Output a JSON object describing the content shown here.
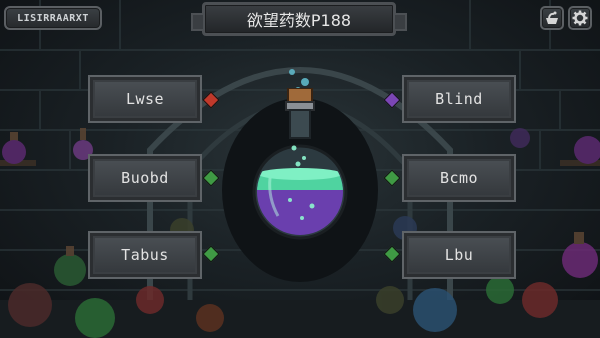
{
  "header": {
    "player_label": "LISIRRAARXT",
    "title": "欲望药数P188"
  },
  "icons": {
    "shop": "potion-shop-icon",
    "settings": "gear-icon"
  },
  "options": {
    "left_top": "Lwse",
    "left_mid": "Buobd",
    "left_bot": "Tabus",
    "right_top": "Blind",
    "right_mid": "Bcmo",
    "right_bot": "Lbu"
  },
  "colors": {
    "gem_red": "#c0392b",
    "gem_green": "#3f9a44",
    "gem_purple": "#7b46b5",
    "potion_liquid_top": "#4fd3a0",
    "potion_liquid_bottom": "#6a3fae"
  }
}
